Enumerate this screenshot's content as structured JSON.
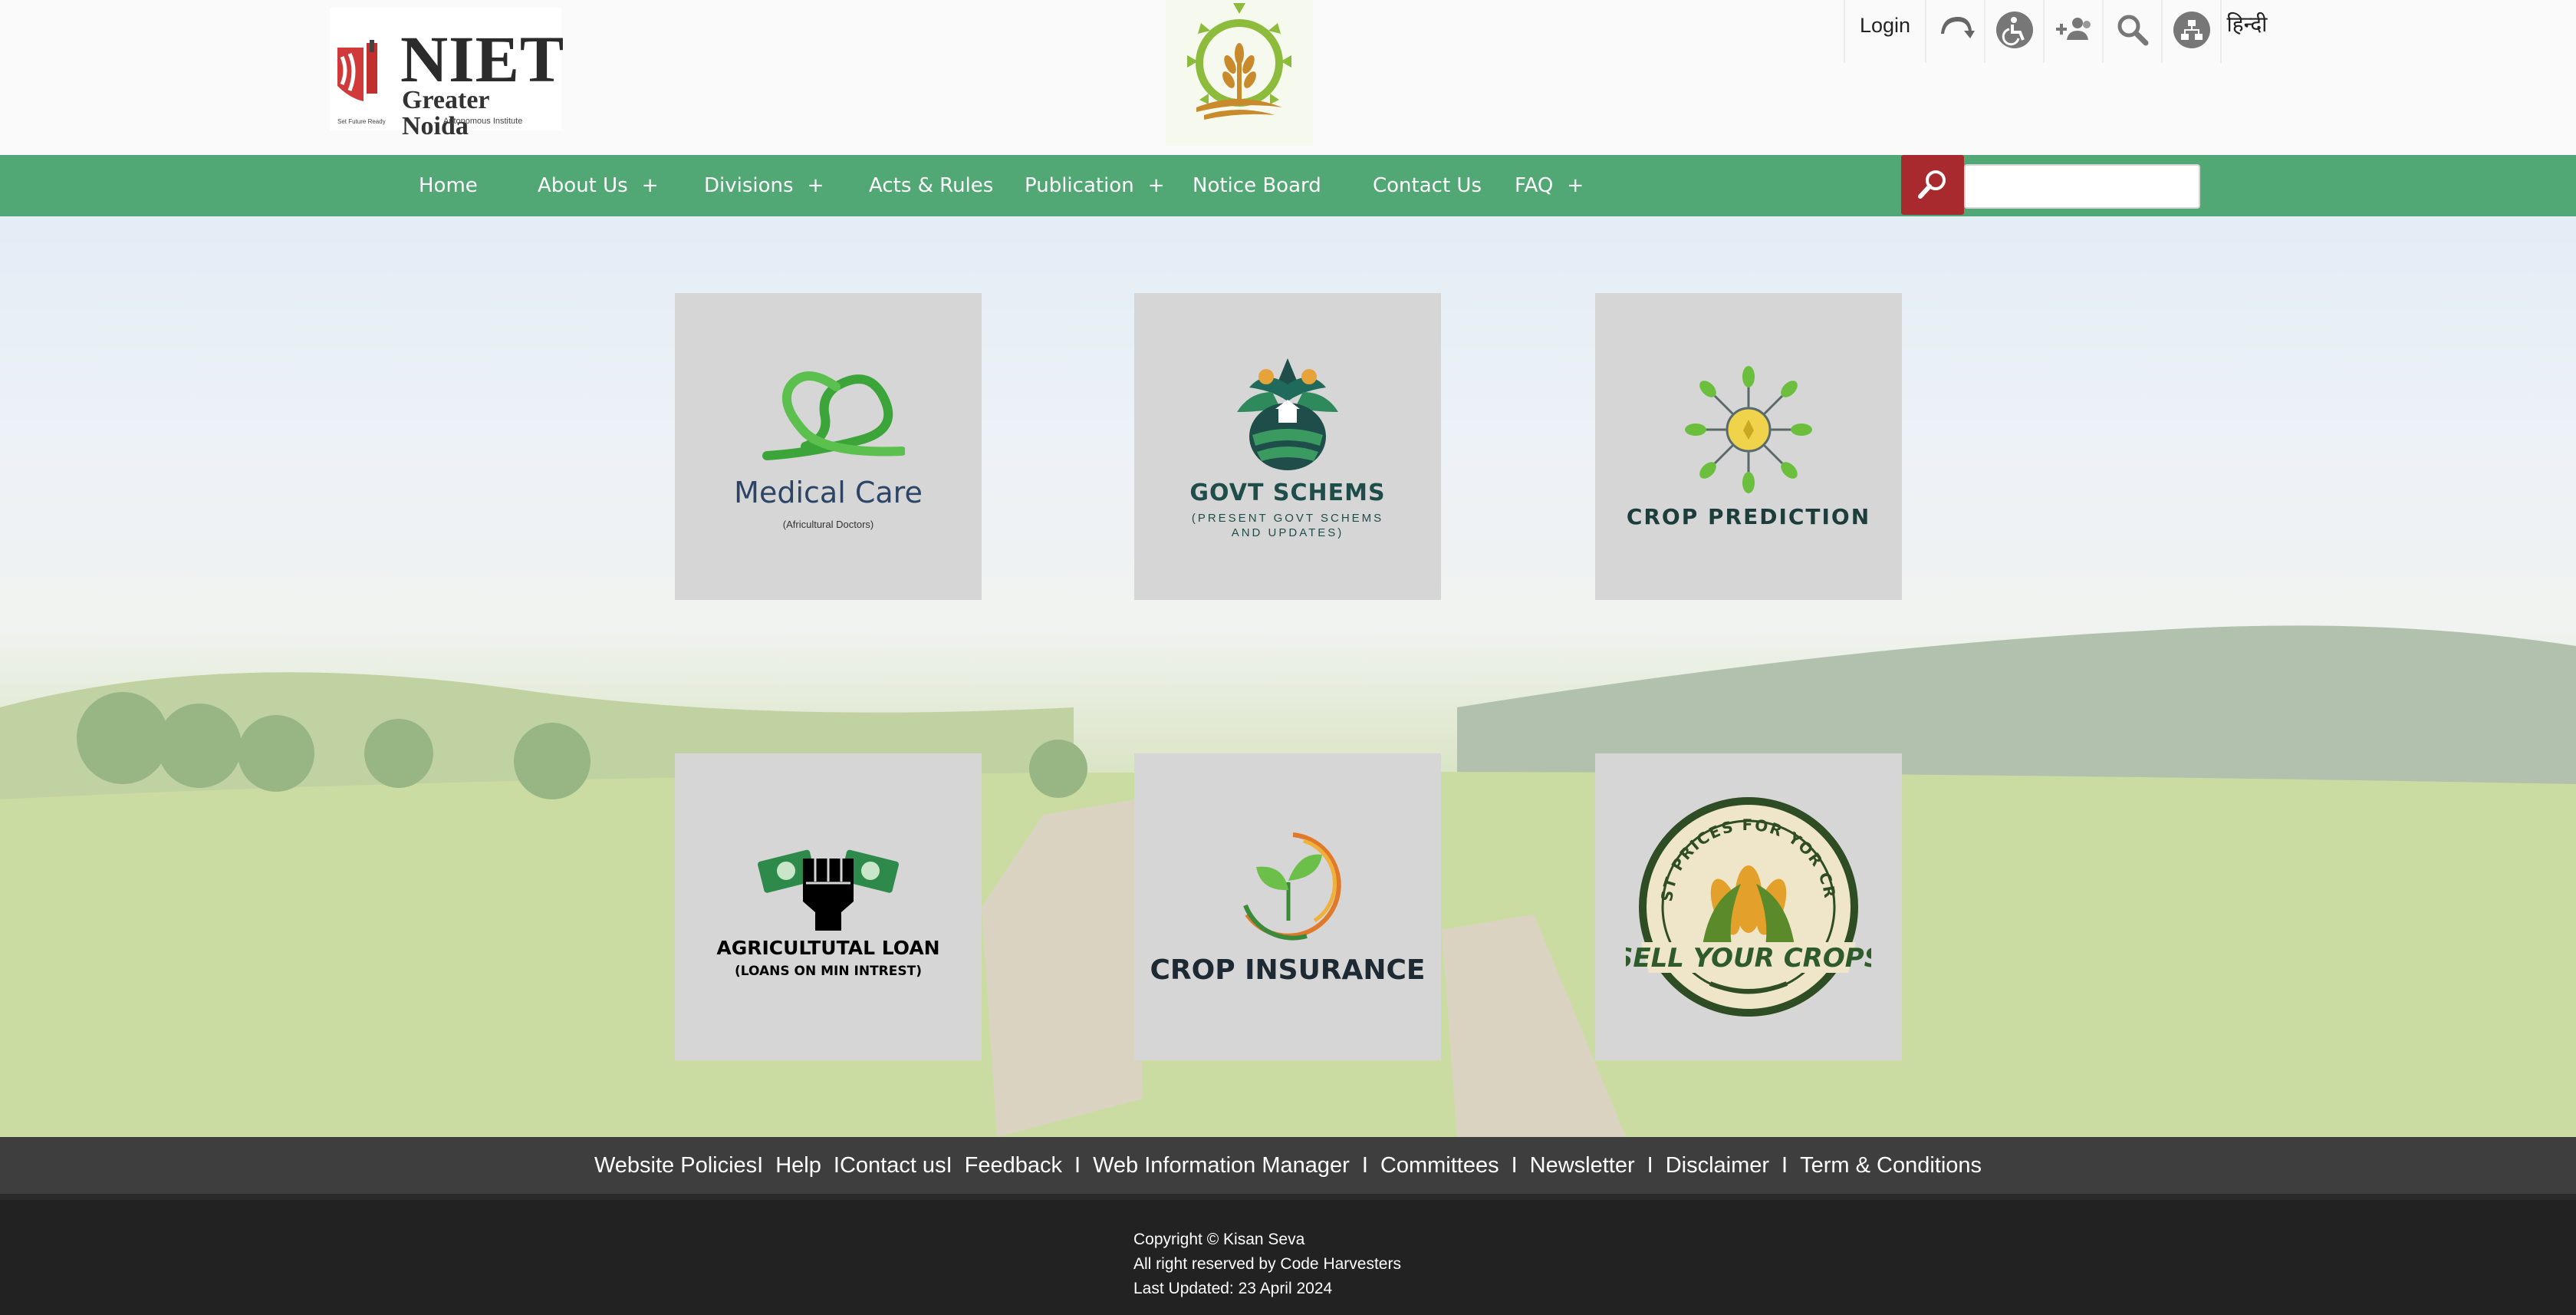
{
  "header": {
    "logo": {
      "name": "NIET",
      "subtitle": "Greater Noida",
      "tagline_left": "Set Future Ready",
      "autonomous": "Autonomous Institute"
    },
    "center_emblem": "wheat-sun-emblem",
    "top_links": {
      "login": "Login",
      "icons": [
        "skip-to-content-icon",
        "accessibility-icon",
        "add-user-icon",
        "search-icon",
        "sitemap-icon"
      ],
      "language": "हिन्दी"
    }
  },
  "nav": {
    "items": [
      {
        "label": "Home",
        "plus": ""
      },
      {
        "label": "About Us",
        "plus": "+"
      },
      {
        "label": "Divisions",
        "plus": "+"
      },
      {
        "label": "Acts & Rules",
        "plus": ""
      },
      {
        "label": "Publication",
        "plus": "+"
      },
      {
        "label": "Notice Board",
        "plus": ""
      },
      {
        "label": "Contact Us",
        "plus": ""
      },
      {
        "label": "FAQ",
        "plus": "+"
      }
    ],
    "search_placeholder": ""
  },
  "services": [
    {
      "title": "Medical Care",
      "subtitle": "(Africultural Doctors)"
    },
    {
      "title": "GOVT SCHEMS",
      "subtitle": "(PRESENT GOVT SCHEMS AND UPDATES)"
    },
    {
      "title": "CROP PREDICTION",
      "subtitle": ""
    },
    {
      "title": "AGRICULTUTAL LOAN",
      "subtitle": "(LOANS ON MIN INTREST)"
    },
    {
      "title": "CROP INSURANCE",
      "subtitle": ""
    },
    {
      "title": "SELL YOUR CROPS",
      "subtitle": "BEST PRICES FOR YOR CROP"
    }
  ],
  "footer": {
    "links": [
      "Website Policies",
      "Help",
      "Contact us",
      "Feedback",
      "Web Information Manager",
      "Committees",
      "Newsletter",
      "Disclaimer",
      "Term & Conditions"
    ],
    "separator": "I",
    "copyright": "Copyright © Kisan Seva",
    "rights": "All right reserved by Code Harvesters",
    "updated": "Last Updated: 23 April 2024"
  },
  "colors": {
    "nav_green": "#52a874",
    "search_red": "#a82a2f",
    "card_gray": "#d6d6d6",
    "footer_dark": "#3e3e3e",
    "footer_darker": "#222222"
  }
}
